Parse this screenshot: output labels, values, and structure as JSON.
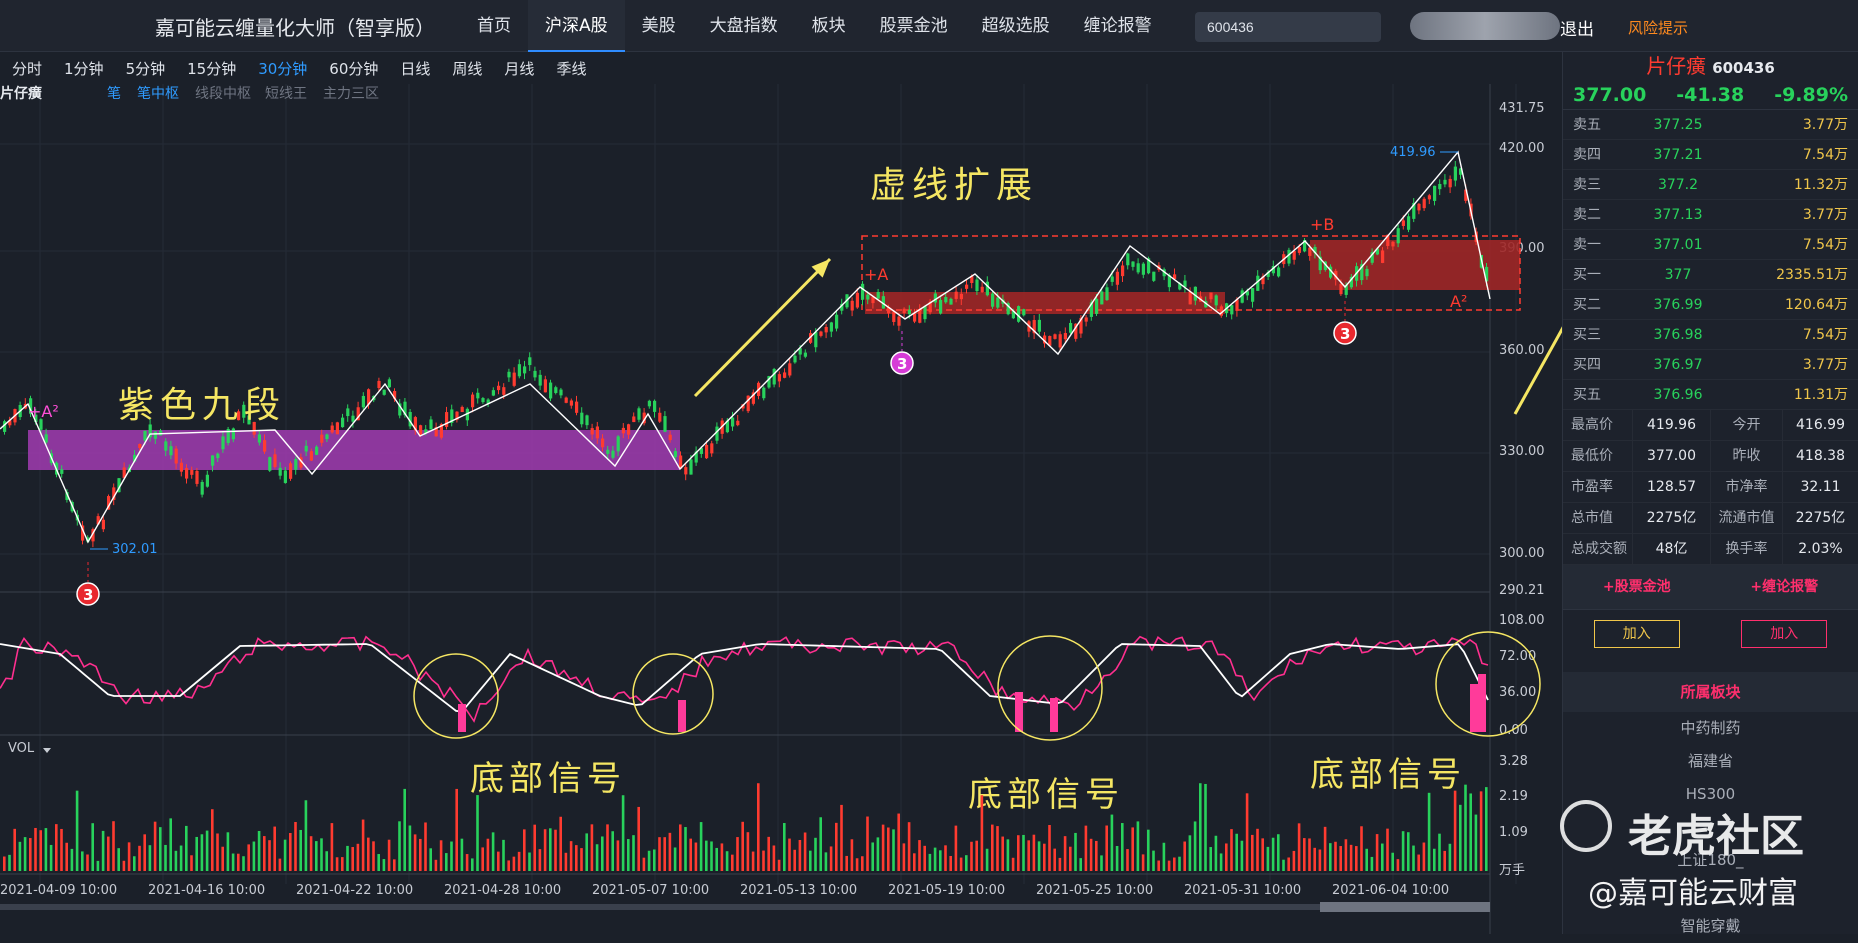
{
  "app_title": "嘉可能云缠量化大师（智享版）",
  "nav": [
    "首页",
    "沪深A股",
    "美股",
    "大盘指数",
    "板块",
    "股票金池",
    "超级选股",
    "缠论报警"
  ],
  "nav_active": 1,
  "search_value": "600436",
  "logout": "退出",
  "risk": "风险提示",
  "periods": [
    "分时",
    "1分钟",
    "5分钟",
    "15分钟",
    "30分钟",
    "60分钟",
    "日线",
    "周线",
    "月线",
    "季线"
  ],
  "period_active": 4,
  "stock_label": "片仔癀",
  "indicator_tabs": [
    "笔",
    "笔中枢",
    "线段中枢",
    "短线王",
    "主力三区"
  ],
  "price_axis": [
    "431.75",
    "420.00",
    "390.00",
    "360.00",
    "330.00",
    "300.00",
    "290.21"
  ],
  "osc_axis": [
    "108.00",
    "72.00",
    "36.00",
    "0.00"
  ],
  "vol_axis": [
    "3.28",
    "2.19",
    "1.09",
    "万手"
  ],
  "vol_label": "VOL",
  "dates": [
    "2021-04-09 10:00",
    "2021-04-16 10:00",
    "2021-04-22 10:00",
    "2021-04-28 10:00",
    "2021-05-07 10:00",
    "2021-05-13 10:00",
    "2021-05-19 10:00",
    "2021-05-25 10:00",
    "2021-05-31 10:00",
    "2021-06-04 10:00"
  ],
  "annotations": {
    "purple": "紫色九段",
    "dashed": "虚线扩展",
    "bottom": "底部信号",
    "plusA2": "+A²",
    "plusA": "+A",
    "plusB": "+B",
    "a2": "A²",
    "low": "302.01",
    "high": "419.96",
    "three": "3"
  },
  "colors": {
    "up": "#ff3b30",
    "down": "#28d25c",
    "purple": "#b43fc4",
    "zone": "#9e2626",
    "yellow": "#f5e663"
  },
  "side": {
    "name": "片仔癀",
    "code": "600436",
    "price": "377.00",
    "change": "-41.38",
    "pct": "-9.89%",
    "orderbook": [
      {
        "label": "卖五",
        "price": "377.25",
        "vol": "3.77万"
      },
      {
        "label": "卖四",
        "price": "377.21",
        "vol": "7.54万"
      },
      {
        "label": "卖三",
        "price": "377.2",
        "vol": "11.32万"
      },
      {
        "label": "卖二",
        "price": "377.13",
        "vol": "3.77万"
      },
      {
        "label": "卖一",
        "price": "377.01",
        "vol": "7.54万"
      },
      {
        "label": "买一",
        "price": "377",
        "vol": "2335.51万"
      },
      {
        "label": "买二",
        "price": "376.99",
        "vol": "120.64万"
      },
      {
        "label": "买三",
        "price": "376.98",
        "vol": "7.54万"
      },
      {
        "label": "买四",
        "price": "376.97",
        "vol": "3.77万"
      },
      {
        "label": "买五",
        "price": "376.96",
        "vol": "11.31万"
      }
    ],
    "stats": [
      {
        "k": "最高价",
        "v": "419.96",
        "k2": "今开",
        "v2": "416.99"
      },
      {
        "k": "最低价",
        "v": "377.00",
        "k2": "昨收",
        "v2": "418.38"
      },
      {
        "k": "市盈率",
        "v": "128.57",
        "k2": "市净率",
        "v2": "32.11"
      },
      {
        "k": "总市值",
        "v": "2275亿",
        "k2": "流通市值",
        "v2": "2275亿"
      },
      {
        "k": "总成交额",
        "v": "48亿",
        "k2": "换手率",
        "v2": "2.03%"
      }
    ],
    "pool": "+股票金池",
    "alarm": "+缠论报警",
    "add": "加入",
    "sector_title": "所属板块",
    "sectors": [
      "中药制药",
      "福建省",
      "HS300",
      "",
      "上证180_",
      "",
      "智能穿戴"
    ]
  },
  "watermark": "老虎社区",
  "watermark_sub": "@嘉可能云财富"
}
